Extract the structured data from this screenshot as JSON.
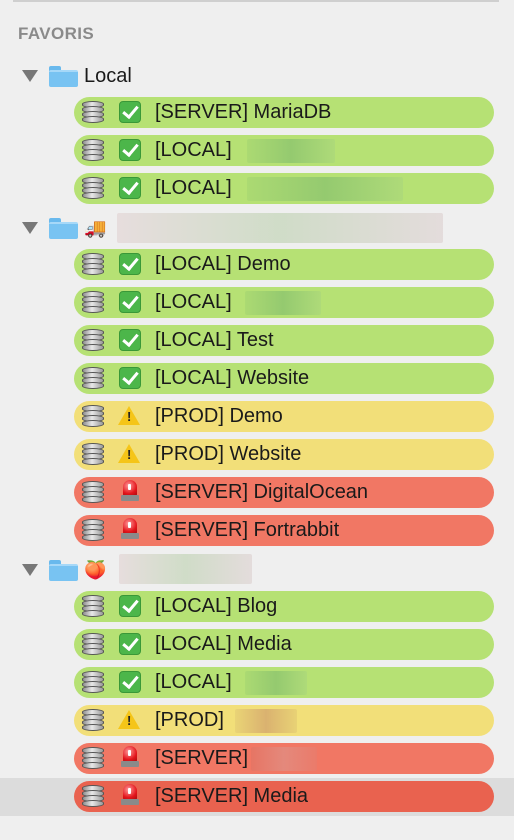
{
  "section_title": "FAVORIS",
  "groups": [
    {
      "label": "Local",
      "items": [
        {
          "label": "[SERVER] MariaDB",
          "color": "green",
          "status": "check"
        },
        {
          "label": "[LOCAL]",
          "color": "green",
          "status": "check"
        },
        {
          "label": "[LOCAL]",
          "color": "green",
          "status": "check"
        }
      ]
    },
    {
      "icon": "🚚",
      "items": [
        {
          "label": "[LOCAL] Demo",
          "color": "green",
          "status": "check"
        },
        {
          "label": "[LOCAL]",
          "color": "green",
          "status": "check"
        },
        {
          "label": "[LOCAL] Test",
          "color": "green",
          "status": "check"
        },
        {
          "label": "[LOCAL] Website",
          "color": "green",
          "status": "check"
        },
        {
          "label": "[PROD] Demo",
          "color": "yellow",
          "status": "warning"
        },
        {
          "label": "[PROD] Website",
          "color": "yellow",
          "status": "warning"
        },
        {
          "label": "[SERVER] DigitalOcean",
          "color": "red",
          "status": "siren"
        },
        {
          "label": "[SERVER] Fortrabbit",
          "color": "red",
          "status": "siren"
        }
      ]
    },
    {
      "icon": "🍑",
      "items": [
        {
          "label": "[LOCAL] Blog",
          "color": "green",
          "status": "check"
        },
        {
          "label": "[LOCAL] Media",
          "color": "green",
          "status": "check"
        },
        {
          "label": "[LOCAL]",
          "color": "green",
          "status": "check"
        },
        {
          "label": "[PROD]",
          "color": "yellow",
          "status": "warning"
        },
        {
          "label": "[SERVER]",
          "color": "red",
          "status": "siren"
        },
        {
          "label": "[SERVER] Media",
          "color": "red",
          "status": "siren",
          "selected": true
        }
      ]
    }
  ],
  "colors": {
    "green": "#b6e174",
    "yellow": "#f2df79",
    "red": "#f17764",
    "selected_red": "#e9624f",
    "folder": "#78c3f2",
    "section_title": "#8a8a8a"
  }
}
